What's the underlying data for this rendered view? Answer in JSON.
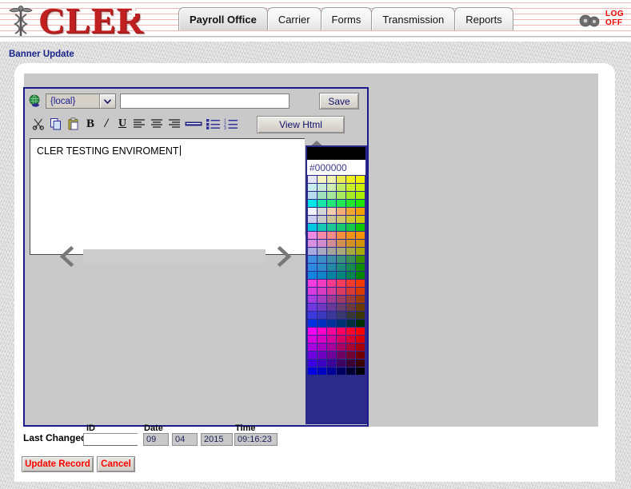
{
  "header": {
    "logo_text": "CLER",
    "logo_icon": "caduceus-icon",
    "gears_icon": "gears-icon",
    "logoff_line1": "LOG",
    "logoff_line2": "OFF",
    "tabs": [
      {
        "label": "Payroll Office",
        "active": true
      },
      {
        "label": "Carrier",
        "active": false
      },
      {
        "label": "Forms",
        "active": false
      },
      {
        "label": "Transmission",
        "active": false
      },
      {
        "label": "Reports",
        "active": false
      }
    ]
  },
  "breadcrumb": "Banner Update",
  "editor": {
    "globe_icon": "globe-icon",
    "location_select": {
      "value": "{local}",
      "options": [
        "{local}"
      ]
    },
    "url_input": {
      "value": "",
      "placeholder": ""
    },
    "save_label": "Save",
    "view_html_label": "View Html",
    "toolbar": [
      {
        "name": "cut-icon",
        "glyph": "✂"
      },
      {
        "name": "copy-icon",
        "glyph": "⧉"
      },
      {
        "name": "paste-icon",
        "glyph": "ὌB"
      },
      {
        "name": "bold-icon",
        "glyph": "B"
      },
      {
        "name": "italic-icon",
        "glyph": "I"
      },
      {
        "name": "underline-icon",
        "glyph": "U"
      },
      {
        "name": "align-left-icon",
        "glyph": "≡"
      },
      {
        "name": "align-center-icon",
        "glyph": "≡"
      },
      {
        "name": "align-right-icon",
        "glyph": "≡"
      },
      {
        "name": "horizontal-rule-icon",
        "glyph": "▬"
      },
      {
        "name": "unordered-list-icon",
        "glyph": "☰"
      },
      {
        "name": "ordered-list-icon",
        "glyph": "☰"
      }
    ],
    "textarea_value": "CLER TESTING ENVIROMENT",
    "scroll_up_icon": "chevron-up-icon",
    "scroll_down_icon": "chevron-down-icon",
    "scroll_left_icon": "chevron-left-icon",
    "scroll_right_icon": "chevron-right-icon"
  },
  "palette": {
    "selected_color": "#000000",
    "hex_label": "#000000",
    "swatches": [
      "#e6e6fa",
      "#f5f5c0",
      "#f2f2b0",
      "#ebeb55",
      "#efef1a",
      "#f0f000",
      "#c8eded",
      "#c9ecd6",
      "#cdeeb0",
      "#c3ec63",
      "#cbef24",
      "#cdf000",
      "#b8dcf0",
      "#9fe0bd",
      "#a8e79a",
      "#a9ea5e",
      "#a7ec22",
      "#a9ef00",
      "#00e6e6",
      "#17e6a8",
      "#24e77b",
      "#22e752",
      "#22e62b",
      "#1ee600",
      "#f2f2ff",
      "#d4d4d4",
      "#f2ceac",
      "#f2ae74",
      "#f2a633",
      "#f2a000",
      "#ccccee",
      "#c8c8c8",
      "#ccc496",
      "#cfc46b",
      "#cfc62f",
      "#d0c800",
      "#00c8e0",
      "#14c8b4",
      "#1dc893",
      "#17c96e",
      "#16c94a",
      "#12c900",
      "#f08ae0",
      "#f58aa8",
      "#f58a88",
      "#f5903e",
      "#f59319",
      "#f59400",
      "#d890e0",
      "#d08ccb",
      "#d08d98",
      "#d09050",
      "#d09323",
      "#d09500",
      "#a8a8e0",
      "#a8a8c0",
      "#a3a39b",
      "#a8a77a",
      "#a7a83e",
      "#a8a900",
      "#3e8ee0",
      "#3e8ec8",
      "#3e8ea8",
      "#3e8f7c",
      "#3a8f52",
      "#389000",
      "#2e8ae0",
      "#2e8ac8",
      "#238aa3",
      "#1d8b78",
      "#178b4e",
      "#0f8c00",
      "#0f84e0",
      "#0f84c8",
      "#0084a0",
      "#00857a",
      "#008550",
      "#008600",
      "#f53ce0",
      "#f53cc0",
      "#f53c8a",
      "#f53c58",
      "#f53b2e",
      "#f53a00",
      "#d83ce0",
      "#d83cc0",
      "#d83c95",
      "#d83c62",
      "#d83b34",
      "#d83a00",
      "#a83ce0",
      "#a83cc0",
      "#a03c92",
      "#9b3c66",
      "#9a3b3a",
      "#9a3a00",
      "#7038e0",
      "#7038c0",
      "#6c3898",
      "#693c6c",
      "#6b3a3c",
      "#6b3a00",
      "#3c38e0",
      "#3c38c0",
      "#3c3898",
      "#3c3870",
      "#38383a",
      "#383800",
      "#0030e0",
      "#0030c0",
      "#00309a",
      "#003070",
      "#003040",
      "#003000",
      "#ff00f0",
      "#ff00c8",
      "#ff0098",
      "#ff0060",
      "#ff0030",
      "#ff0000",
      "#d800e0",
      "#d800c0",
      "#d80098",
      "#d80060",
      "#d80030",
      "#d80000",
      "#a800e0",
      "#a800c0",
      "#a80098",
      "#a80060",
      "#a80030",
      "#a80000",
      "#7000e0",
      "#7000c0",
      "#700098",
      "#700060",
      "#700030",
      "#700000",
      "#3c00e0",
      "#3c00c0",
      "#3c0098",
      "#3c0060",
      "#3c0030",
      "#3c0000",
      "#0000e0",
      "#0000c0",
      "#000098",
      "#000060",
      "#000030",
      "#000000"
    ]
  },
  "footer": {
    "last_changed_label": "Last Changed:",
    "id_label": "ID",
    "id_value": "",
    "date_label": "Date",
    "date_month": "09",
    "date_day": "04",
    "date_year": "2015",
    "time_label": "Time",
    "time_value": "09:16:23",
    "update_label": "Update Record",
    "cancel_label": "Cancel"
  }
}
